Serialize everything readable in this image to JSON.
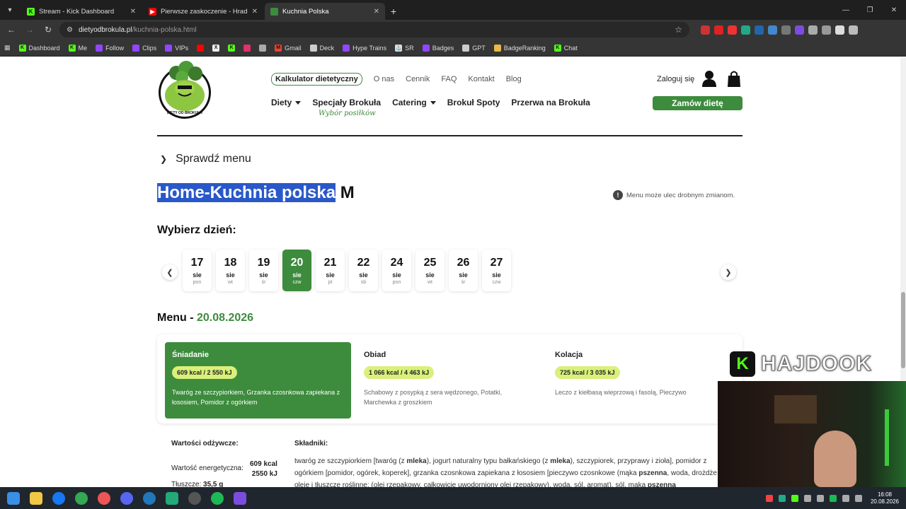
{
  "browser": {
    "tabs": [
      {
        "title": "Stream - Kick Dashboard",
        "active": false
      },
      {
        "title": "Pierwsze zaskoczenie - Hradec",
        "active": false
      },
      {
        "title": "Kuchnia Polska",
        "active": true
      }
    ],
    "url_domain": "dietyodbrokula.pl",
    "url_path": "/kuchnia-polska.html",
    "bookmarks": [
      "Dashboard",
      "Me",
      "Follow",
      "Clips",
      "VIPs",
      "Gmail",
      "Deck",
      "Hype Trains",
      "SR",
      "Badges",
      "GPT",
      "BadgeRanking",
      "Chat"
    ]
  },
  "header": {
    "top_nav": [
      "Kalkulator dietetyczny",
      "O nas",
      "Cennik",
      "FAQ",
      "Kontakt",
      "Blog"
    ],
    "main_nav": [
      {
        "label": "Diety",
        "dropdown": true
      },
      {
        "label": "Specjały Brokuła",
        "dropdown": false
      },
      {
        "label": "Catering",
        "dropdown": true
      },
      {
        "label": "Brokuł Spoty",
        "dropdown": false
      },
      {
        "label": "Przerwa na Brokuła",
        "dropdown": false
      }
    ],
    "subtag": "Wybór posiłków",
    "login": "Zaloguj się",
    "order_button": "Zamów dietę",
    "logo_text": "DIETY OD BROKUŁA"
  },
  "content": {
    "menu_toggle": "Sprawdź menu",
    "heading_selected": "Home-Kuchnia polska",
    "heading_rest": " M",
    "notice": "Menu może ulec drobnym zmianom.",
    "pick_day": "Wybierz dzień:",
    "days": [
      {
        "num": "17",
        "mon": "sie",
        "dow": "pon"
      },
      {
        "num": "18",
        "mon": "sie",
        "dow": "wt"
      },
      {
        "num": "19",
        "mon": "sie",
        "dow": "śr"
      },
      {
        "num": "20",
        "mon": "sie",
        "dow": "czw"
      },
      {
        "num": "21",
        "mon": "sie",
        "dow": "pt"
      },
      {
        "num": "22",
        "mon": "sie",
        "dow": "sb"
      },
      {
        "num": "24",
        "mon": "sie",
        "dow": "pon"
      },
      {
        "num": "25",
        "mon": "sie",
        "dow": "wt"
      },
      {
        "num": "26",
        "mon": "sie",
        "dow": "śr"
      },
      {
        "num": "27",
        "mon": "sie",
        "dow": "czw"
      }
    ],
    "selected_day_index": 3,
    "menu_title": "Menu - ",
    "menu_date": "20.08.2026",
    "meals": [
      {
        "name": "Śniadanie",
        "kcal": "609 kcal / 2 550 kJ",
        "desc": "Twaróg ze szczypiorkiem, Grzanka czosnkowa zapiekana z łososiem, Pomidor z ogórkiem"
      },
      {
        "name": "Obiad",
        "kcal": "1 066 kcal / 4 463 kJ",
        "desc": "Schabowy z posypką z sera wędzonego, Potatki, Marchewka z groszkiem"
      },
      {
        "name": "Kolacja",
        "kcal": "725 kcal / 3 035 kJ",
        "desc": "Leczo z kiełbasą wieprzową i fasolą, Pieczywo"
      }
    ],
    "nutrition_title": "Wartości odżywcze:",
    "energy_label": "Wartość energetyczna:",
    "energy_kcal": "609 kcal",
    "energy_kj": "2550 kJ",
    "fat_label": "Tłuszcze:",
    "fat_value": "35,5 g",
    "ingredients_title": "Składniki:",
    "ingredients_text": "twaróg ze szczypiorkiem [twaróg (z mleka), jogurt naturalny typu bałkańskiego (z mleka), szczypiorek, przyprawy i zioła], pomidor z ogórkiem [pomidor, ogórek, koperek], grzanka czosnkowa zapiekana z łososiem [pieczywo czosnkowe (mąka pszenna, woda, drożdże, oleje i tłuszcze roślinne: (olej rzepakowy, całkowicie uwodorniony olej rzepakowy), woda, sól, aromat), sól, mąka pszenna"
  },
  "overlay": {
    "channel": "HAJDOOK"
  },
  "taskbar": {
    "time": "16:08",
    "date": "20.08.2026"
  },
  "colors": {
    "brand_green": "#3d8b3d",
    "kcal_badge": "#d9f07a",
    "selection": "#2958c9"
  }
}
